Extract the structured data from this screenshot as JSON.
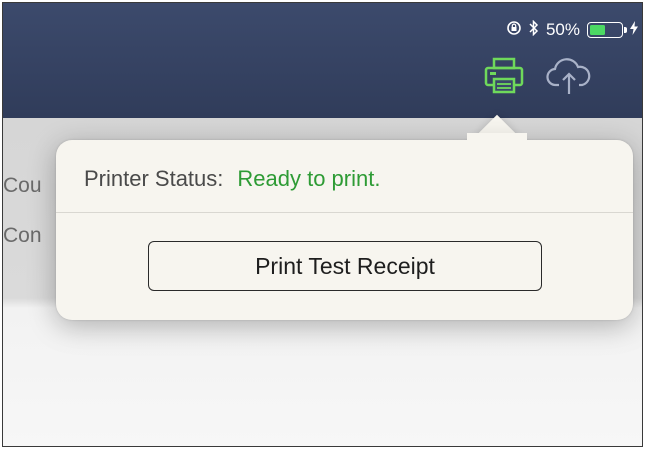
{
  "status_bar": {
    "orientation_lock_icon": "orientation-lock-icon",
    "bluetooth_icon": "bluetooth-icon",
    "battery_percent_label": "50%",
    "battery_level": 0.5,
    "charging_icon": "charging-bolt-icon"
  },
  "toolbar": {
    "printer_icon": "printer-icon",
    "cloud_upload_icon": "cloud-upload-icon",
    "printer_active_color": "#6fd95b",
    "cloud_color": "#a9b2c8"
  },
  "background_list": {
    "items": [
      "Cou",
      "Con"
    ]
  },
  "popover": {
    "status_label": "Printer Status:",
    "status_value": "Ready to print.",
    "status_color": "#2e9b35",
    "print_button_label": "Print Test Receipt"
  }
}
